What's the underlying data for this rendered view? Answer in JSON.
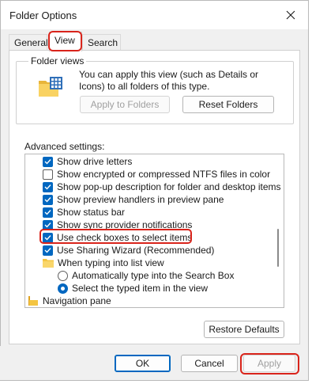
{
  "window": {
    "title": "Folder Options",
    "close_icon": "close-icon"
  },
  "tabs": [
    {
      "label": "General",
      "active": false
    },
    {
      "label": "View",
      "active": true
    },
    {
      "label": "Search",
      "active": false
    }
  ],
  "folder_views": {
    "label": "Folder views",
    "icon": "folder-views-icon",
    "description": "You can apply this view (such as Details or Icons) to all folders of this type.",
    "apply_button": "Apply to Folders",
    "reset_button": "Reset Folders"
  },
  "advanced": {
    "label": "Advanced settings:",
    "items": [
      {
        "type": "checkbox",
        "checked": true,
        "label": "Show drive letters"
      },
      {
        "type": "checkbox",
        "checked": false,
        "label": "Show encrypted or compressed NTFS files in color"
      },
      {
        "type": "checkbox",
        "checked": true,
        "label": "Show pop-up description for folder and desktop items"
      },
      {
        "type": "checkbox",
        "checked": true,
        "label": "Show preview handlers in preview pane"
      },
      {
        "type": "checkbox",
        "checked": true,
        "label": "Show status bar"
      },
      {
        "type": "checkbox",
        "checked": true,
        "label": "Show sync provider notifications"
      },
      {
        "type": "checkbox",
        "checked": true,
        "label": "Use check boxes to select items"
      },
      {
        "type": "checkbox",
        "checked": true,
        "label": "Use Sharing Wizard (Recommended)"
      },
      {
        "type": "folder",
        "label": "When typing into list view"
      },
      {
        "type": "radio",
        "selected": false,
        "label": "Automatically type into the Search Box"
      },
      {
        "type": "radio",
        "selected": true,
        "label": "Select the typed item in the view"
      },
      {
        "type": "nav",
        "label": "Navigation pane"
      }
    ]
  },
  "buttons": {
    "restore": "Restore Defaults",
    "ok": "OK",
    "cancel": "Cancel",
    "apply": "Apply"
  },
  "colors": {
    "accent": "#0067c0",
    "highlight": "#d9241b",
    "folder": "#f4c542"
  }
}
